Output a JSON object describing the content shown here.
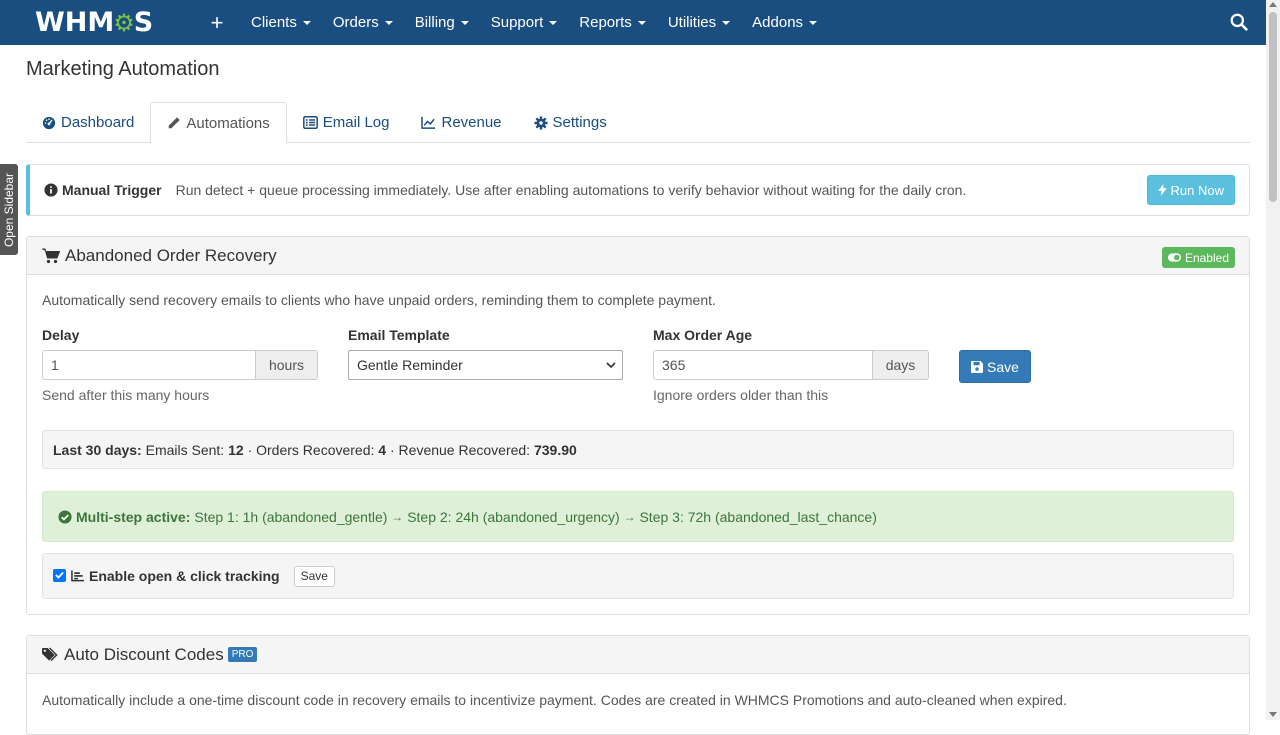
{
  "nav": {
    "logo_pre": "WHM",
    "logo_post": "S",
    "plus": "+",
    "items": [
      "Clients",
      "Orders",
      "Billing",
      "Support",
      "Reports",
      "Utilities",
      "Addons"
    ]
  },
  "sidebar_toggle": "Open Sidebar",
  "page_title": "Marketing Automation",
  "tabs": [
    {
      "label": "Dashboard",
      "icon": "dashboard-icon"
    },
    {
      "label": "Automations",
      "icon": "pencil-icon"
    },
    {
      "label": "Email Log",
      "icon": "list-icon"
    },
    {
      "label": "Revenue",
      "icon": "line-chart-icon"
    },
    {
      "label": "Settings",
      "icon": "gear-icon"
    }
  ],
  "active_tab": "Automations",
  "trigger": {
    "title": "Manual Trigger",
    "text": "Run detect + queue processing immediately. Use after enabling automations to verify behavior without waiting for the daily cron.",
    "button": "Run Now"
  },
  "abandoned": {
    "title": "Abandoned Order Recovery",
    "status": "Enabled",
    "description": "Automatically send recovery emails to clients who have unpaid orders, reminding them to complete payment.",
    "delay": {
      "label": "Delay",
      "value": "1",
      "unit": "hours",
      "help": "Send after this many hours"
    },
    "template": {
      "label": "Email Template",
      "value": "Gentle Reminder"
    },
    "max_age": {
      "label": "Max Order Age",
      "value": "365",
      "unit": "days",
      "help": "Ignore orders older than this"
    },
    "save": "Save",
    "stats": {
      "period": "Last 30 days:",
      "emails_label": "Emails Sent:",
      "emails": "12",
      "orders_label": "Orders Recovered:",
      "orders": "4",
      "revenue_label": "Revenue Recovered:",
      "revenue": "739.90",
      "sep": "·"
    },
    "multistep": {
      "label": "Multi-step active:",
      "step1": "Step 1: 1h (abandoned_gentle)",
      "step2": "Step 2: 24h (abandoned_urgency)",
      "step3": "Step 3: 72h (abandoned_last_chance)",
      "arrow": "→"
    },
    "tracking": {
      "label": "Enable open & click tracking",
      "checked": true,
      "save": "Save"
    }
  },
  "discount": {
    "title": "Auto Discount Codes",
    "badge": "PRO",
    "description": "Automatically include a one-time discount code in recovery emails to incentivize payment. Codes are created in WHMCS Promotions and auto-cleaned when expired."
  },
  "colors": {
    "nav": "#1a4d80",
    "info": "#5bc0de",
    "success": "#5cb85c",
    "primary": "#337ab7"
  }
}
